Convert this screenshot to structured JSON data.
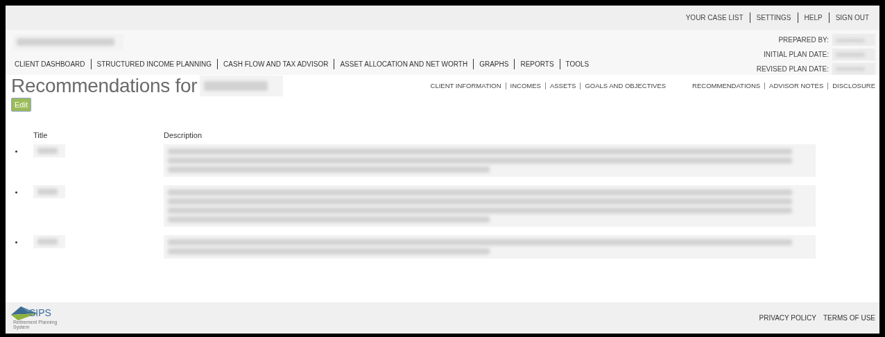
{
  "top_links": [
    "YOUR CASE LIST",
    "SETTINGS",
    "HELP",
    "SIGN OUT"
  ],
  "main_nav": [
    "CLIENT DASHBOARD",
    "STRUCTURED INCOME PLANNING",
    "CASH FLOW AND TAX ADVISOR",
    "ASSET ALLOCATION AND NET WORTH",
    "GRAPHS",
    "REPORTS",
    "TOOLS"
  ],
  "plan_info": [
    {
      "label": "PREPARED BY:"
    },
    {
      "label": "INITIAL PLAN DATE:"
    },
    {
      "label": "REVISED PLAN DATE:"
    }
  ],
  "page_title": "Recommendations for",
  "sub_nav_left": [
    "CLIENT INFORMATION",
    "INCOMES",
    "ASSETS",
    "GOALS AND OBJECTIVES"
  ],
  "sub_nav_right": [
    "RECOMMENDATIONS",
    "ADVISOR NOTES",
    "DISCLOSURE"
  ],
  "edit_button": "Edit",
  "table": {
    "columns": [
      "Title",
      "Description"
    ],
    "rows": [
      {
        "kind": "redacted",
        "description_lines": [
          {
            "kind": "full"
          },
          {
            "kind": "full"
          },
          {
            "kind": "partial"
          }
        ]
      },
      {
        "kind": "redacted",
        "description_lines": [
          {
            "kind": "full"
          },
          {
            "kind": "full"
          },
          {
            "kind": "full"
          },
          {
            "kind": "partial"
          }
        ]
      },
      {
        "kind": "redacted",
        "description_lines": [
          {
            "kind": "full"
          },
          {
            "kind": "partial"
          }
        ]
      }
    ]
  },
  "footer": {
    "logo_text": "SIPS",
    "logo_subtitle": "Retirement Planning System",
    "links": [
      "PRIVACY POLICY",
      "TERMS OF USE"
    ]
  }
}
